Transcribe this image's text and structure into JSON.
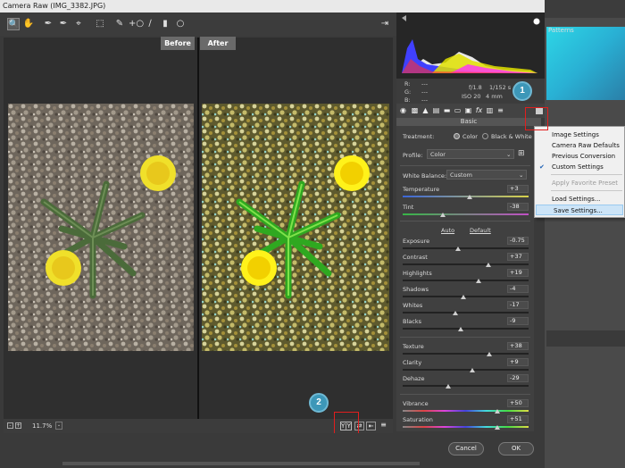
{
  "window": {
    "title": "Camera Raw (IMG_3382.JPG)"
  },
  "toolbar": {
    "tools": [
      "zoom-tool-icon",
      "hand-tool-icon",
      "white-balance-tool-icon",
      "color-sampler-icon",
      "targeted-adjustment-icon",
      "crop-icon",
      "straighten-icon",
      "spot-removal-icon",
      "red-eye-icon",
      "adjustment-brush-icon",
      "graduated-filter-icon",
      "radial-filter-icon"
    ]
  },
  "preview": {
    "before_label": "Before",
    "after_label": "After",
    "zoom_value": "11.7%"
  },
  "histogram": {
    "r_label": "R:",
    "g_label": "G:",
    "b_label": "B:",
    "r_value": "---",
    "g_value": "---",
    "b_value": "---",
    "aperture": "f/1.8",
    "shutter": "1/152 s",
    "iso": "ISO 20",
    "focal": "4 mm"
  },
  "basic": {
    "header": "Basic",
    "treatment_label": "Treatment:",
    "treatment_color": "Color",
    "treatment_bw": "Black & White",
    "profile_label": "Profile:",
    "profile_value": "Color",
    "wb_label": "White Balance:",
    "wb_value": "Custom",
    "auto_label": "Auto",
    "default_label": "Default",
    "sliders": [
      {
        "name": "Temperature",
        "value": "+3",
        "pos": 0.53
      },
      {
        "name": "Tint",
        "value": "-38",
        "pos": 0.32
      },
      {
        "name": "Exposure",
        "value": "-0.75",
        "pos": 0.44
      },
      {
        "name": "Contrast",
        "value": "+37",
        "pos": 0.68
      },
      {
        "name": "Highlights",
        "value": "+19",
        "pos": 0.6
      },
      {
        "name": "Shadows",
        "value": "-4",
        "pos": 0.48
      },
      {
        "name": "Whites",
        "value": "-17",
        "pos": 0.42
      },
      {
        "name": "Blacks",
        "value": "-9",
        "pos": 0.46
      },
      {
        "name": "Texture",
        "value": "+38",
        "pos": 0.69
      },
      {
        "name": "Clarity",
        "value": "+9",
        "pos": 0.55
      },
      {
        "name": "Dehaze",
        "value": "-29",
        "pos": 0.36
      },
      {
        "name": "Vibrance",
        "value": "+50",
        "pos": 0.75
      },
      {
        "name": "Saturation",
        "value": "+51",
        "pos": 0.75
      }
    ]
  },
  "menu": {
    "items": [
      {
        "label": "Image Settings",
        "checked": false,
        "disabled": false
      },
      {
        "label": "Camera Raw Defaults",
        "checked": false,
        "disabled": false
      },
      {
        "label": "Previous Conversion",
        "checked": false,
        "disabled": false
      },
      {
        "label": "Custom Settings",
        "checked": true,
        "disabled": false
      },
      {
        "label": "Apply Favorite Preset",
        "checked": false,
        "disabled": true
      },
      {
        "label": "Load Settings...",
        "checked": false,
        "disabled": false
      },
      {
        "label": "Save Settings...",
        "checked": false,
        "disabled": false,
        "highlighted": true
      }
    ]
  },
  "callouts": {
    "one": "1",
    "two": "2"
  },
  "background_panel": {
    "patterns_label": "Patterns"
  },
  "footer": {
    "cancel_label": "Cancel",
    "ok_label": "OK"
  },
  "colors": {
    "accent": "#3d97b8",
    "highlight_box": "#e21e1e",
    "menu_highlight": "#cce4f7"
  }
}
